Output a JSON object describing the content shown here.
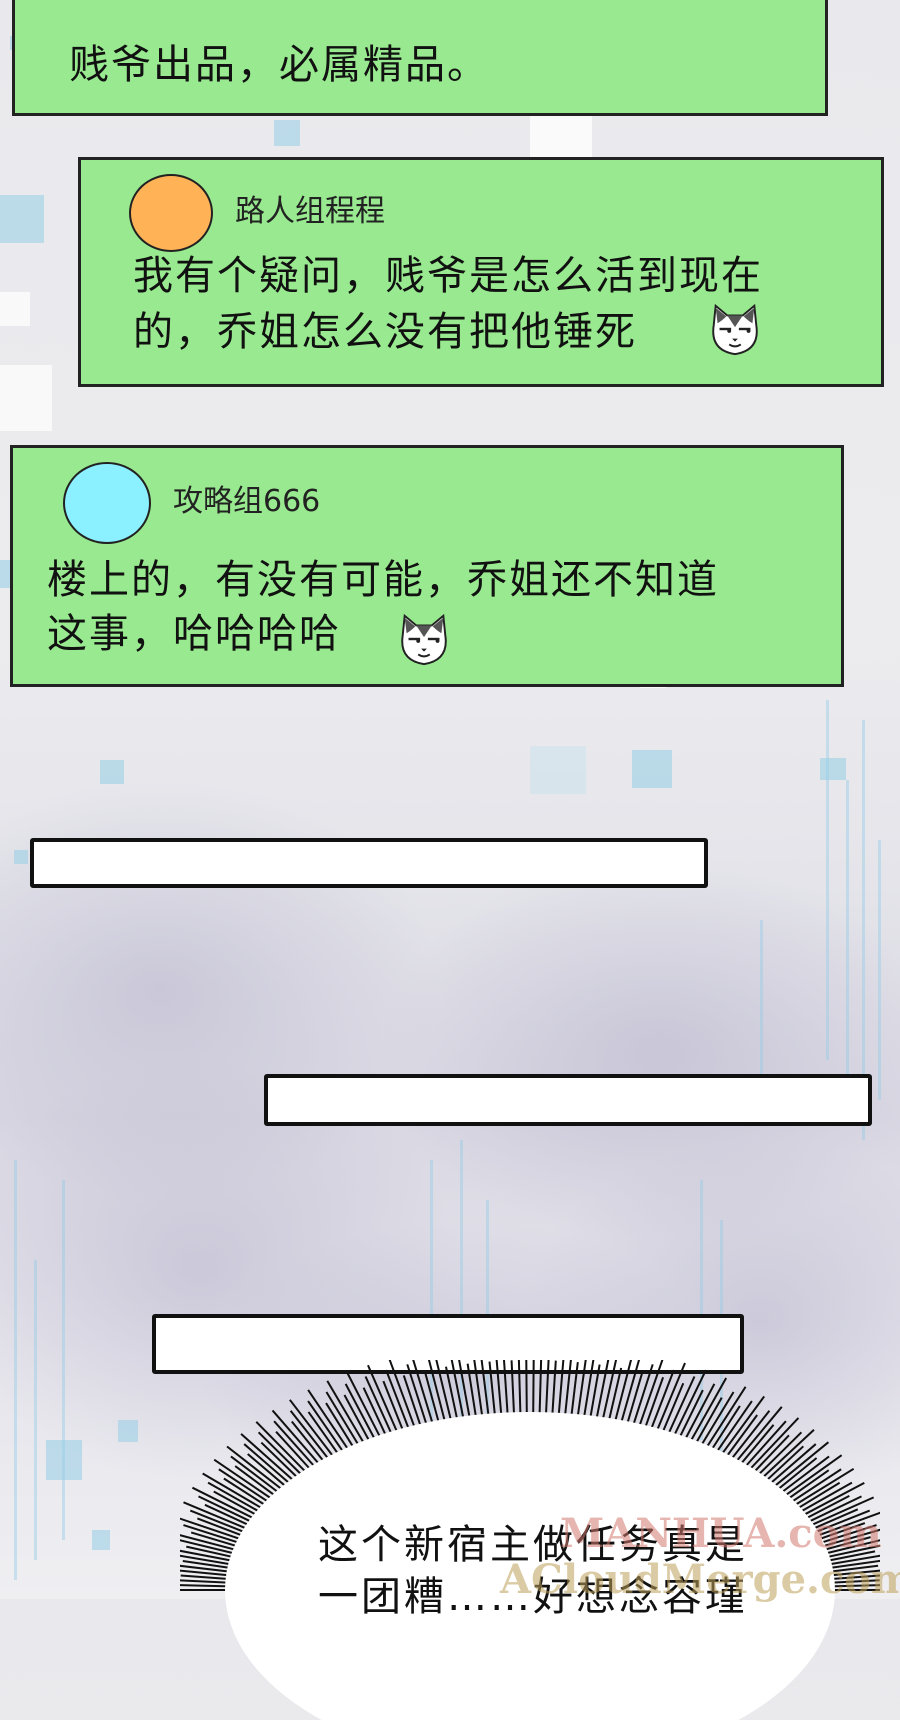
{
  "messages": [
    {
      "text": "贱爷出品，必属精品。"
    },
    {
      "username": "路人组程程",
      "avatar_color": "#ffb256",
      "text_line1": "我有个疑问，贱爷是怎么活到现在",
      "text_line2": "的，乔姐怎么没有把他锤死",
      "emoji": "cat-smirk-icon"
    },
    {
      "username": "攻略组666",
      "avatar_color": "#8bf0ff",
      "text_line1": "楼上的，有没有可能，乔姐还不知道",
      "text_line2": "这事，哈哈哈哈",
      "emoji": "cat-smirk-icon"
    }
  ],
  "colors": {
    "bubble": "#98e98f",
    "border": "#222222",
    "bar_fill": "#ffffff"
  },
  "narration": {
    "line1": "这个新宿主做任务真是",
    "line2": "一团糟……好想念容瑾"
  },
  "watermark": {
    "line1": "MANHUA.com",
    "line2": "ACloudMerge.com"
  }
}
